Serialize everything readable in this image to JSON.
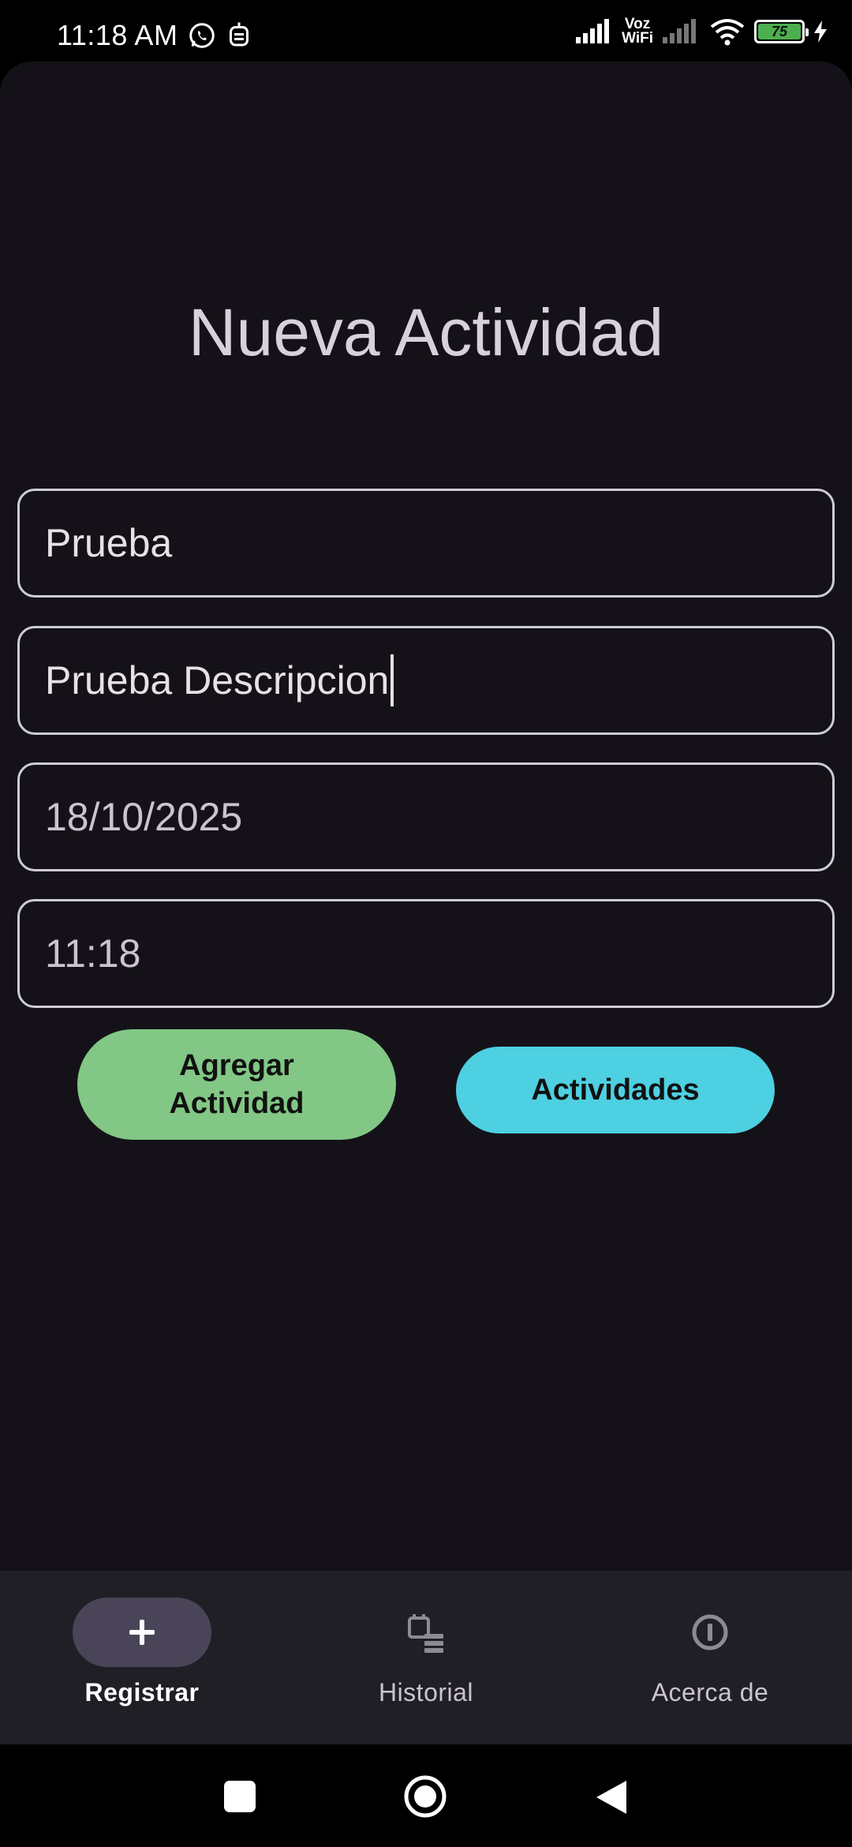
{
  "status_bar": {
    "time": "11:18 AM",
    "voz": "Voz",
    "wifi": "WiFi",
    "battery": "75"
  },
  "screen": {
    "title": "Nueva Actividad"
  },
  "form": {
    "name_value": "Prueba",
    "description_value": "Prueba Descripcion",
    "date_value": "18/10/2025",
    "time_value": "11:18"
  },
  "buttons": {
    "add_line1": "Agregar",
    "add_line2": "Actividad",
    "list": "Actividades"
  },
  "bottom_nav": {
    "items": [
      {
        "label": "Registrar",
        "icon": "plus-icon",
        "active": true
      },
      {
        "label": "Historial",
        "icon": "history-icon",
        "active": false
      },
      {
        "label": "Acerca de",
        "icon": "info-icon",
        "active": false
      }
    ]
  },
  "colors": {
    "background": "#141218",
    "add_button": "#82c785",
    "list_button": "#4dd0e1",
    "nav_active_pill": "#4a4458",
    "battery": "#4caf50"
  }
}
